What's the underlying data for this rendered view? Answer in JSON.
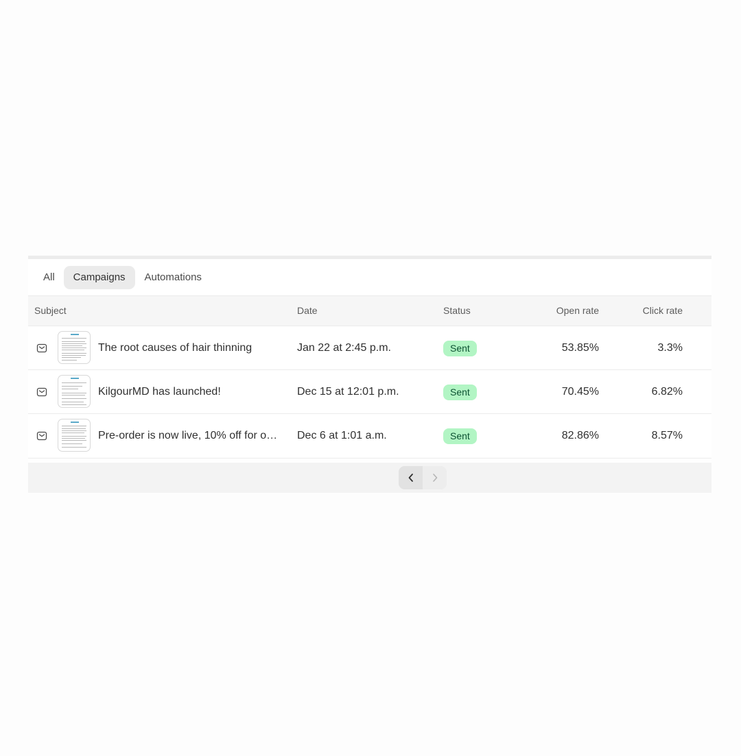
{
  "tabs": [
    {
      "label": "All",
      "active": false
    },
    {
      "label": "Campaigns",
      "active": true
    },
    {
      "label": "Automations",
      "active": false
    }
  ],
  "columns": {
    "subject": "Subject",
    "date": "Date",
    "status": "Status",
    "open_rate": "Open rate",
    "click_rate": "Click rate"
  },
  "rows": [
    {
      "icon": "mail-icon",
      "subject": "The root causes of hair thinning",
      "date": "Jan 22 at 2:45 p.m.",
      "status": "Sent",
      "open_rate": "53.85%",
      "click_rate": "3.3%"
    },
    {
      "icon": "mail-icon",
      "subject": "KilgourMD has launched!",
      "date": "Dec 15 at 12:01 p.m.",
      "status": "Sent",
      "open_rate": "70.45%",
      "click_rate": "6.82%"
    },
    {
      "icon": "mail-icon",
      "subject": "Pre-order is now live, 10% off for o…",
      "date": "Dec 6 at 1:01 a.m.",
      "status": "Sent",
      "open_rate": "82.86%",
      "click_rate": "8.57%"
    }
  ],
  "pagination": {
    "prev_icon": "chevron-left-icon",
    "next_icon": "chevron-right-icon"
  },
  "colors": {
    "status_sent_bg": "#b2f5c4",
    "status_sent_text": "#0c5132",
    "header_bg": "#f6f6f6"
  }
}
